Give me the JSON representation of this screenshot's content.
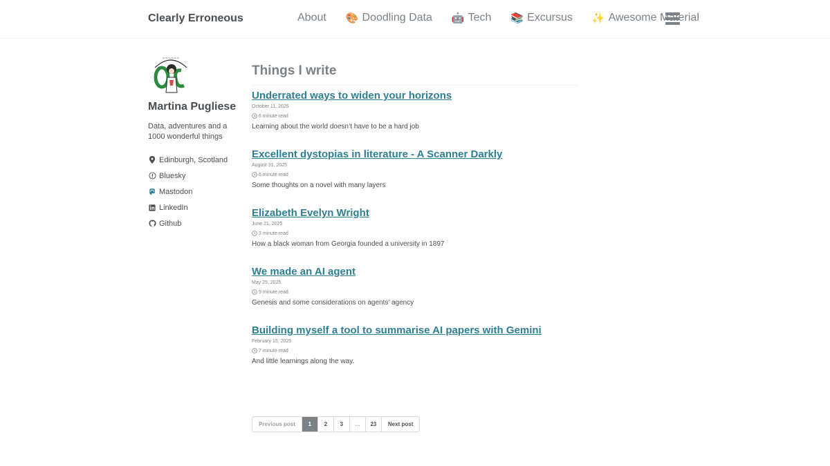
{
  "site": {
    "title": "Clearly Erroneous"
  },
  "nav": {
    "items": [
      {
        "emoji": "",
        "label": "About"
      },
      {
        "emoji": "🎨",
        "label": "Doodling Data"
      },
      {
        "emoji": "🤖",
        "label": "Tech"
      },
      {
        "emoji": "📚",
        "label": "Excursus"
      },
      {
        "emoji": "✨",
        "label": "Awesome Material"
      }
    ],
    "menu_icon": "hamburger-menu-icon"
  },
  "author": {
    "name": "Martina Pugliese",
    "bio": "Data, adventures and a 1000 wonderful things",
    "links": [
      {
        "icon": "map-marker-icon",
        "label": "Edinburgh, Scotland"
      },
      {
        "icon": "bluesky-icon",
        "label": "Bluesky"
      },
      {
        "icon": "mastodon-icon",
        "label": "Mastodon"
      },
      {
        "icon": "linkedin-icon",
        "label": "LinkedIn"
      },
      {
        "icon": "github-icon",
        "label": "Github"
      }
    ]
  },
  "main": {
    "heading": "Things I write",
    "posts": [
      {
        "title": "Underrated ways to widen your horizons",
        "date": "October 11, 2025",
        "read_time": "6 minute read",
        "excerpt": "Learning about the world doesn’t have to be a hard job"
      },
      {
        "title": "Excellent dystopias in literature - A Scanner Darkly",
        "date": "August 31, 2025",
        "read_time": "6 minute read",
        "excerpt": "Some thoughts on a novel with many layers"
      },
      {
        "title": "Elizabeth Evelyn Wright",
        "date": "June 21, 2025",
        "read_time": "3 minute read",
        "excerpt": "How a black woman from Georgia founded a university in 1897"
      },
      {
        "title": "We made an AI agent",
        "date": "May 25, 2025",
        "read_time": "9 minute read",
        "excerpt": "Genesis and some considerations on agents’ agency"
      },
      {
        "title": "Building myself a tool to summarise AI papers with Gemini",
        "date": "February 15, 2025",
        "read_time": "7 minute read",
        "excerpt": "And little learnings along the way."
      }
    ]
  },
  "pagination": {
    "previous": "Previous post",
    "pages": [
      "1",
      "2",
      "3",
      "…",
      "23"
    ],
    "current": "1",
    "next": "Next post"
  },
  "colors": {
    "link": "#2f7f93",
    "text": "#494e52",
    "muted": "#7a8288",
    "active_page_bg": "#7a8288"
  }
}
